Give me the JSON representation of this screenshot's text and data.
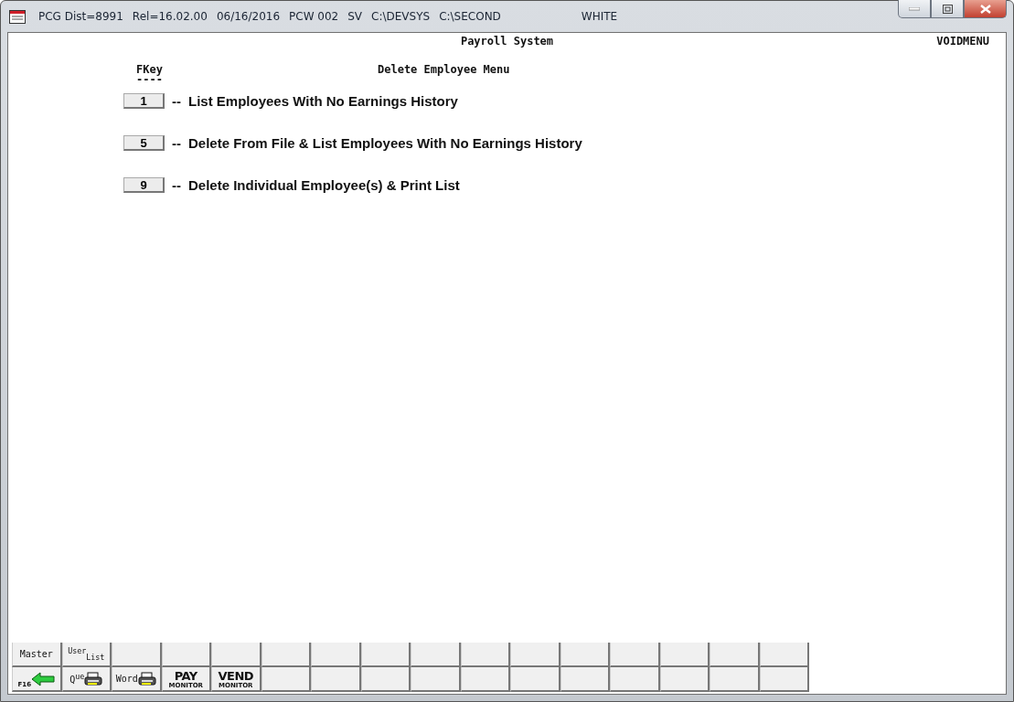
{
  "window": {
    "title_parts": [
      "PCG Dist=8991",
      "Rel=16.02.00",
      "06/16/2016",
      "PCW 002",
      "SV",
      "C:\\DEVSYS",
      "C:\\SECOND"
    ],
    "theme": "WHITE"
  },
  "header": {
    "title": "Payroll System",
    "screen_id": "VOIDMENU"
  },
  "menu": {
    "key_heading": "FKey",
    "key_rule": "----",
    "title": "Delete Employee Menu",
    "items": [
      {
        "key": "1",
        "separator": "--",
        "label": "List Employees With No Earnings History"
      },
      {
        "key": "5",
        "separator": "--",
        "label": "Delete From File & List Employees With No Earnings History"
      },
      {
        "key": "9",
        "separator": "--",
        "label": "Delete Individual Employee(s) & Print List"
      }
    ]
  },
  "toolbar": {
    "rows": [
      [
        {
          "kind": "text",
          "label": "Master"
        },
        {
          "kind": "text",
          "label": "$^{User}$$_{List}$"
        },
        {
          "kind": "empty"
        },
        {
          "kind": "empty"
        },
        {
          "kind": "empty"
        },
        {
          "kind": "empty"
        },
        {
          "kind": "empty"
        },
        {
          "kind": "empty"
        },
        {
          "kind": "empty"
        },
        {
          "kind": "empty"
        },
        {
          "kind": "empty"
        },
        {
          "kind": "empty"
        },
        {
          "kind": "empty"
        },
        {
          "kind": "empty"
        },
        {
          "kind": "empty"
        },
        {
          "kind": "empty"
        }
      ],
      [
        {
          "kind": "back",
          "label": "F16"
        },
        {
          "kind": "printer",
          "label": "Q$^{ue}$"
        },
        {
          "kind": "printer",
          "label": "Word"
        },
        {
          "kind": "monitor",
          "label": "PAY",
          "sublabel": "MONITOR"
        },
        {
          "kind": "monitor",
          "label": "VEND",
          "sublabel": "MONITOR"
        },
        {
          "kind": "empty"
        },
        {
          "kind": "empty"
        },
        {
          "kind": "empty"
        },
        {
          "kind": "empty"
        },
        {
          "kind": "empty"
        },
        {
          "kind": "empty"
        },
        {
          "kind": "empty"
        },
        {
          "kind": "empty"
        },
        {
          "kind": "empty"
        },
        {
          "kind": "empty"
        },
        {
          "kind": "empty"
        }
      ]
    ]
  }
}
